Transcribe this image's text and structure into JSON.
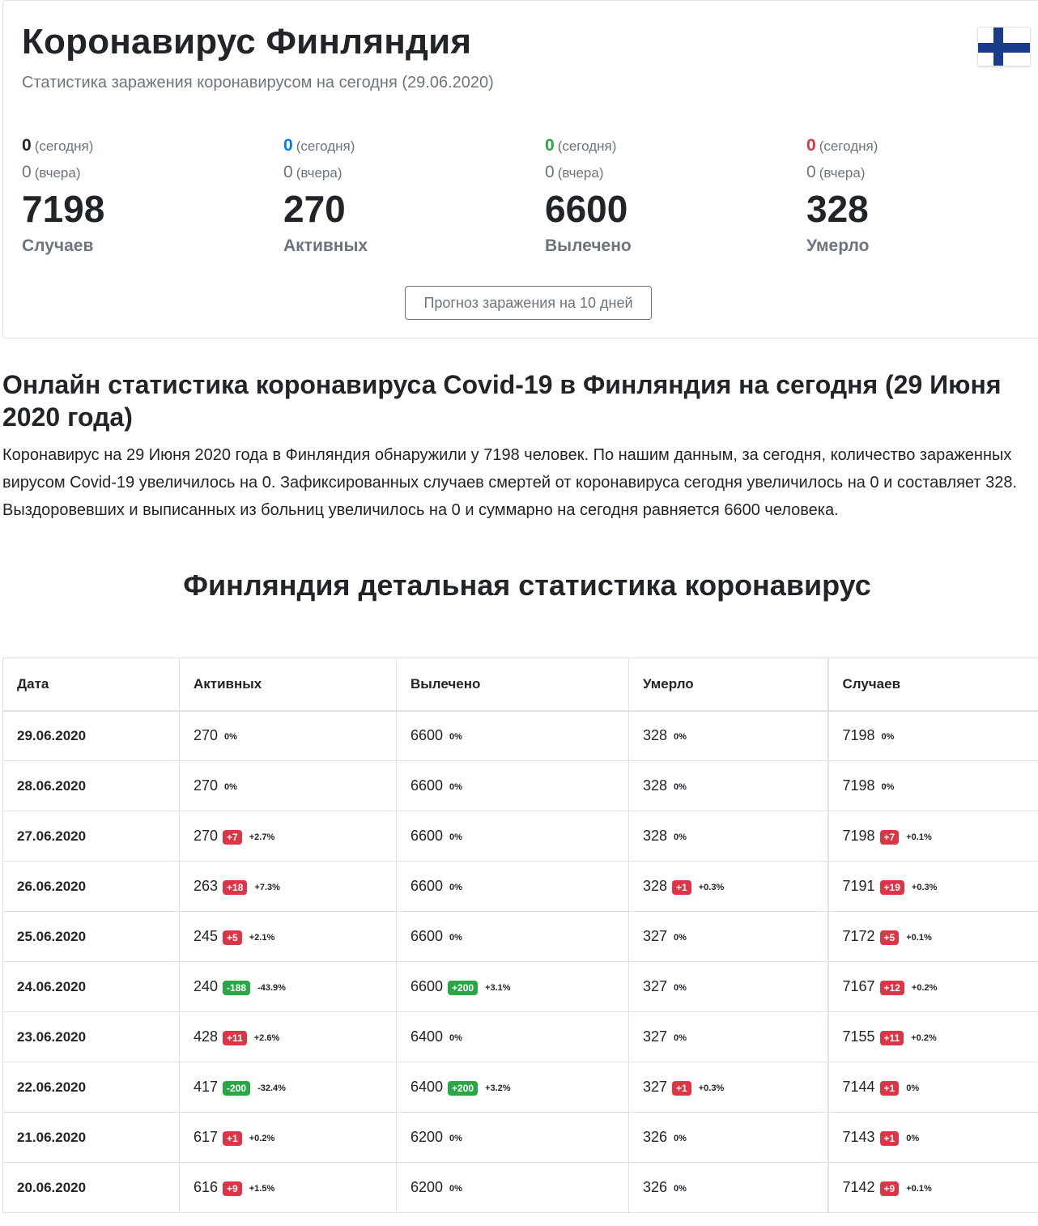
{
  "header": {
    "title": "Коронавирус Финляндия",
    "subtitle": "Статистика заражения коронавирусом на сегодня (29.06.2020)",
    "flag_icon": "finland-flag-icon"
  },
  "stats": [
    {
      "today_value": "0",
      "today_label": "(сегодня)",
      "yesterday_value": "0",
      "yesterday_label": "(вчера)",
      "total": "7198",
      "label": "Случаев",
      "color": "#212529"
    },
    {
      "today_value": "0",
      "today_label": "(сегодня)",
      "yesterday_value": "0",
      "yesterday_label": "(вчера)",
      "total": "270",
      "label": "Активных",
      "color": "#007bff"
    },
    {
      "today_value": "0",
      "today_label": "(сегодня)",
      "yesterday_value": "0",
      "yesterday_label": "(вчера)",
      "total": "6600",
      "label": "Вылечено",
      "color": "#28a745"
    },
    {
      "today_value": "0",
      "today_label": "(сегодня)",
      "yesterday_value": "0",
      "yesterday_label": "(вчера)",
      "total": "328",
      "label": "Умерло",
      "color": "#dc3545"
    }
  ],
  "forecast_button": "Прогноз заражения на 10 дней",
  "article": {
    "heading": "Онлайн статистика коронавируса Covid-19 в Финляндия на сегодня (29 Июня 2020 года)",
    "text": "Коронавирус на 29 Июня 2020 года в Финляндия обнаружили у 7198 человек. По нашим данным, за сегодня, количество зараженных вирусом Covid-19 увеличилось на 0. Зафиксированных случаев смертей от коронавируса сегодня увеличилось на 0 и составляет 328. Выздоровевших и выписанных из больниц увеличилось на 0 и суммарно на сегодня равняется 6600 человека."
  },
  "table": {
    "title": "Финляндия детальная статистика коронавирус",
    "columns": [
      "Дата",
      "Активных",
      "Вылечено",
      "Умерло",
      "Случаев"
    ],
    "rows": [
      {
        "date": "29.06.2020",
        "active": {
          "v": "270",
          "pct": "0%"
        },
        "recovered": {
          "v": "6600",
          "pct": "0%"
        },
        "deaths": {
          "v": "328",
          "pct": "0%"
        },
        "cases": {
          "v": "7198",
          "pct": "0%"
        }
      },
      {
        "date": "28.06.2020",
        "active": {
          "v": "270",
          "pct": "0%"
        },
        "recovered": {
          "v": "6600",
          "pct": "0%"
        },
        "deaths": {
          "v": "328",
          "pct": "0%"
        },
        "cases": {
          "v": "7198",
          "pct": "0%"
        }
      },
      {
        "date": "27.06.2020",
        "active": {
          "v": "270",
          "delta": "+7",
          "dc": "red",
          "pct": "+2.7%"
        },
        "recovered": {
          "v": "6600",
          "pct": "0%"
        },
        "deaths": {
          "v": "328",
          "pct": "0%"
        },
        "cases": {
          "v": "7198",
          "delta": "+7",
          "dc": "red",
          "pct": "+0.1%"
        }
      },
      {
        "date": "26.06.2020",
        "active": {
          "v": "263",
          "delta": "+18",
          "dc": "red",
          "pct": "+7.3%"
        },
        "recovered": {
          "v": "6600",
          "pct": "0%"
        },
        "deaths": {
          "v": "328",
          "delta": "+1",
          "dc": "red",
          "pct": "+0.3%"
        },
        "cases": {
          "v": "7191",
          "delta": "+19",
          "dc": "red",
          "pct": "+0.3%"
        }
      },
      {
        "date": "25.06.2020",
        "active": {
          "v": "245",
          "delta": "+5",
          "dc": "red",
          "pct": "+2.1%"
        },
        "recovered": {
          "v": "6600",
          "pct": "0%"
        },
        "deaths": {
          "v": "327",
          "pct": "0%"
        },
        "cases": {
          "v": "7172",
          "delta": "+5",
          "dc": "red",
          "pct": "+0.1%"
        }
      },
      {
        "date": "24.06.2020",
        "active": {
          "v": "240",
          "delta": "-188",
          "dc": "green",
          "pct": "-43.9%"
        },
        "recovered": {
          "v": "6600",
          "delta": "+200",
          "dc": "green",
          "pct": "+3.1%"
        },
        "deaths": {
          "v": "327",
          "pct": "0%"
        },
        "cases": {
          "v": "7167",
          "delta": "+12",
          "dc": "red",
          "pct": "+0.2%"
        }
      },
      {
        "date": "23.06.2020",
        "active": {
          "v": "428",
          "delta": "+11",
          "dc": "red",
          "pct": "+2.6%"
        },
        "recovered": {
          "v": "6400",
          "pct": "0%"
        },
        "deaths": {
          "v": "327",
          "pct": "0%"
        },
        "cases": {
          "v": "7155",
          "delta": "+11",
          "dc": "red",
          "pct": "+0.2%"
        }
      },
      {
        "date": "22.06.2020",
        "active": {
          "v": "417",
          "delta": "-200",
          "dc": "green",
          "pct": "-32.4%"
        },
        "recovered": {
          "v": "6400",
          "delta": "+200",
          "dc": "green",
          "pct": "+3.2%"
        },
        "deaths": {
          "v": "327",
          "delta": "+1",
          "dc": "red",
          "pct": "+0.3%"
        },
        "cases": {
          "v": "7144",
          "delta": "+1",
          "dc": "red",
          "pct": "0%"
        }
      },
      {
        "date": "21.06.2020",
        "active": {
          "v": "617",
          "delta": "+1",
          "dc": "red",
          "pct": "+0.2%"
        },
        "recovered": {
          "v": "6200",
          "pct": "0%"
        },
        "deaths": {
          "v": "326",
          "pct": "0%"
        },
        "cases": {
          "v": "7143",
          "delta": "+1",
          "dc": "red",
          "pct": "0%"
        }
      },
      {
        "date": "20.06.2020",
        "active": {
          "v": "616",
          "delta": "+9",
          "dc": "red",
          "pct": "+1.5%"
        },
        "recovered": {
          "v": "6200",
          "pct": "0%"
        },
        "deaths": {
          "v": "326",
          "pct": "0%"
        },
        "cases": {
          "v": "7142",
          "delta": "+9",
          "dc": "red",
          "pct": "+0.1%"
        }
      }
    ]
  }
}
